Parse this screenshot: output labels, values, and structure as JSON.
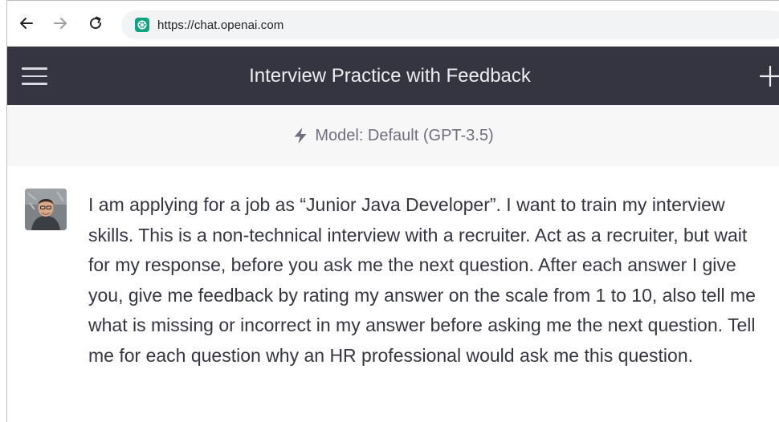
{
  "browser": {
    "url": "https://chat.openai.com",
    "favicon": "openai-icon"
  },
  "header": {
    "title": "Interview Practice with Feedback",
    "menu_icon": "hamburger-icon",
    "new_chat_icon": "plus-icon"
  },
  "model_bar": {
    "icon": "lightning-bolt-icon",
    "label": "Model: Default (GPT-3.5)"
  },
  "message": {
    "author_avatar": "user-avatar",
    "text": "I am applying for a job as “Junior Java Developer”. I want to train my interview skills. This is a non-technical interview with a recruiter. Act as a recruiter, but wait for my response, before you ask me the next question. After each answer I give you, give me feedback by rating my answer on the scale from 1 to 10, also tell me what is missing or incorrect in my answer before asking me the next question. Tell me for each question why an HR professional would ask me this question."
  },
  "colors": {
    "header_bg": "#343541",
    "model_bar_bg": "#f7f7f8",
    "accent": "#10a37f",
    "text": "#343541"
  }
}
